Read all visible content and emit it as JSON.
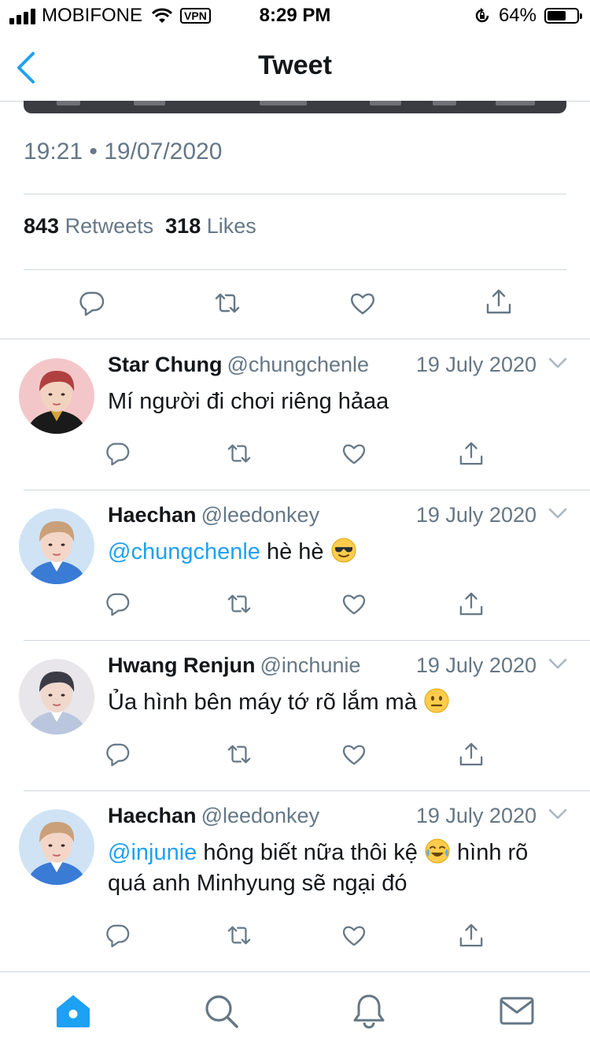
{
  "status_bar": {
    "carrier": "MOBIFONE",
    "vpn": "VPN",
    "time": "8:29 PM",
    "battery": "64%",
    "battery_level": 0.64
  },
  "nav": {
    "title": "Tweet",
    "back_icon": "chevron-left-icon"
  },
  "tweet": {
    "timestamp": "19:21 • 19/07/2020",
    "retweets_count": "843",
    "retweets_label": "Retweets",
    "likes_count": "318",
    "likes_label": "Likes"
  },
  "replies": [
    {
      "name": "Star Chung",
      "handle": "@chungchenle",
      "date": "19 July 2020",
      "segments": [
        {
          "type": "text",
          "value": "Mí người đi chơi riêng hảaa"
        }
      ]
    },
    {
      "name": "Haechan",
      "handle": "@leedonkey",
      "date": "19 July 2020",
      "segments": [
        {
          "type": "mention",
          "value": "@chungchenle"
        },
        {
          "type": "text",
          "value": " hè hè "
        },
        {
          "type": "emoji",
          "value": "sunglasses-emoji"
        }
      ]
    },
    {
      "name": "Hwang Renjun",
      "handle": "@inchunie",
      "date": "19 July 2020",
      "segments": [
        {
          "type": "text",
          "value": "Ủa hình bên máy tớ rõ lắm mà "
        },
        {
          "type": "emoji",
          "value": "neutral-face-emoji"
        }
      ]
    },
    {
      "name": "Haechan",
      "handle": "@leedonkey",
      "date": "19 July 2020",
      "segments": [
        {
          "type": "mention",
          "value": "@injunie"
        },
        {
          "type": "text",
          "value": " hông biết nữa thôi kệ "
        },
        {
          "type": "emoji",
          "value": "tears-of-joy-emoji"
        },
        {
          "type": "text",
          "value": " hình rõ quá anh Minhyung sẽ ngại đó"
        }
      ]
    }
  ],
  "tabs": [
    "home-icon",
    "search-icon",
    "notifications-icon",
    "messages-icon"
  ],
  "colors": {
    "accent": "#1da1f2",
    "secondary_text": "#657786",
    "divider": "#cfd6dc",
    "icon": "#657786"
  }
}
